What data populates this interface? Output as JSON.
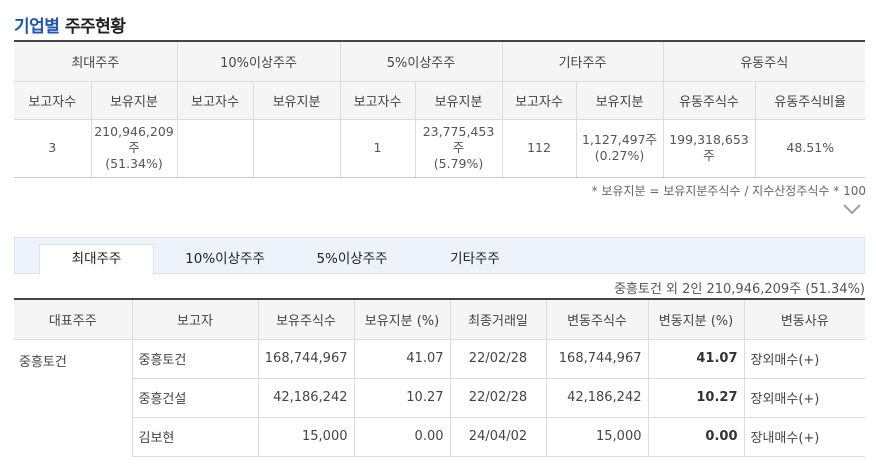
{
  "page_title": {
    "company": "기업별",
    "rest": "주주현황"
  },
  "summary": {
    "groups": [
      "최대주주",
      "10%이상주주",
      "5%이상주주",
      "기타주주",
      "유동주식"
    ],
    "subheaders": [
      "보고자수",
      "보유지분",
      "보고자수",
      "보유지분",
      "보고자수",
      "보유지분",
      "보고자수",
      "보유지분",
      "유동주식수",
      "유동주식비율"
    ],
    "cells": [
      [
        "3"
      ],
      [
        "210,946,209",
        "주",
        "(51.34%)"
      ],
      [
        ""
      ],
      [
        ""
      ],
      [
        "1"
      ],
      [
        "23,775,453",
        "주",
        "(5.79%)"
      ],
      [
        "112"
      ],
      [
        "1,127,497주",
        "(0.27%)"
      ],
      [
        "199,318,653",
        "주"
      ],
      [
        "48.51%"
      ]
    ]
  },
  "footnote": "* 보유지분 = 보유지분주식수 / 지수산정주식수 * 100",
  "tabs": [
    "최대주주",
    "10%이상주주",
    "5%이상주주",
    "기타주주"
  ],
  "active_tab": "최대주주",
  "holder_summary": "중흥토건 외 2인 210,946,209주 (51.34%)",
  "detail": {
    "headers": [
      "대표주주",
      "보고자",
      "보유주식수",
      "보유지분 (%)",
      "최종거래일",
      "변동주식수",
      "변동지분 (%)",
      "변동사유"
    ],
    "representative": "중흥토건",
    "rows": [
      {
        "reporter": "중흥토건",
        "shares": "168,744,967",
        "pct": "41.07",
        "last_trade": "22/02/28",
        "change_shares": "168,744,967",
        "change_pct": "41.07",
        "reason": "장외매수(+)"
      },
      {
        "reporter": "중흥건설",
        "shares": "42,186,242",
        "pct": "10.27",
        "last_trade": "22/02/28",
        "change_shares": "42,186,242",
        "change_pct": "10.27",
        "reason": "장외매수(+)"
      },
      {
        "reporter": "김보현",
        "shares": "15,000",
        "pct": "0.00",
        "last_trade": "24/04/02",
        "change_shares": "15,000",
        "change_pct": "0.00",
        "reason": "장내매수(+)"
      }
    ]
  },
  "icons": {
    "expand": "chevron-down-icon"
  },
  "colors": {
    "title_accent": "#2155b9",
    "tab_bar": "#eef3fb"
  }
}
